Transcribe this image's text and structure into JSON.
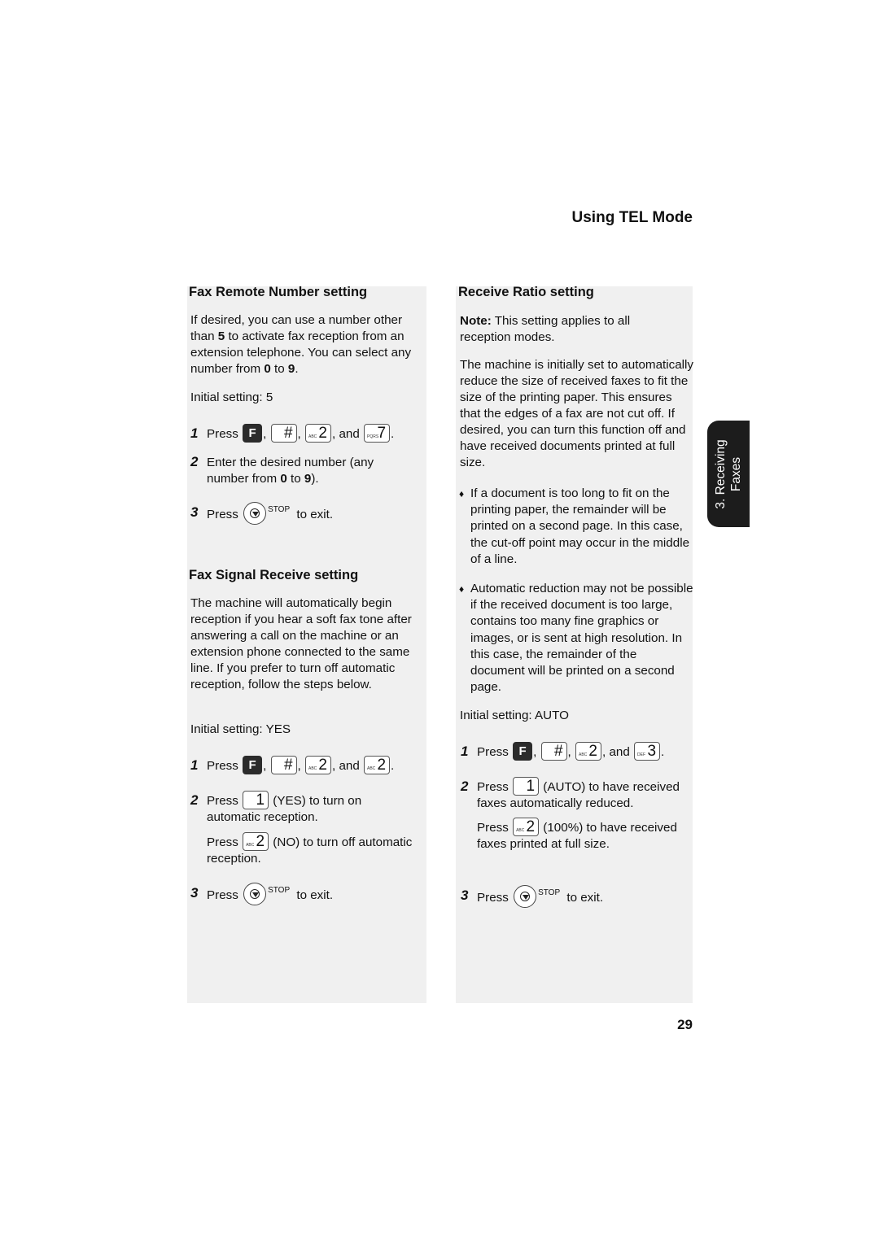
{
  "header": {
    "title": "Using TEL Mode"
  },
  "side_tab": {
    "line1": "3. Receiving",
    "line2": "Faxes"
  },
  "page_number": "29",
  "keys": {
    "f": "F",
    "hash": "#",
    "two": "2",
    "two_sub": "ABC",
    "seven": "7",
    "seven_sub": "PQRS",
    "three": "3",
    "three_sub": "DEF",
    "one": "1",
    "stop_label": "STOP"
  },
  "left": {
    "fax_remote": {
      "title": "Fax Remote Number setting",
      "intro": [
        "If desired, you can use a number other than ",
        "5",
        " to activate fax reception from an extension telephone. You can select any number from ",
        "0",
        " to ",
        "9",
        "."
      ],
      "initial": "Initial setting: 5",
      "step1": {
        "num": "1",
        "press": "Press",
        "sep1": ",",
        "sep2": ",",
        "and": ", and",
        "end": "."
      },
      "step2": {
        "num": "2",
        "text_a": "Enter the desired number (any number from ",
        "b1": "0",
        "text_b": " to ",
        "b2": "9",
        "text_c": ")."
      },
      "step3": {
        "num": "3",
        "press": "Press",
        "exit": "to exit."
      }
    },
    "fax_signal": {
      "title": "Fax Signal Receive setting",
      "intro": "The machine will automatically begin reception if you hear a soft fax tone after answering a call on the machine or an extension phone connected to the same line. If you prefer to turn off automatic reception, follow the steps below.",
      "initial": "Initial setting: YES",
      "step1": {
        "num": "1",
        "press": "Press",
        "sep1": ",",
        "sep2": ",",
        "and": ", and",
        "end": "."
      },
      "step2": {
        "num": "2",
        "press": "Press",
        "yes_text": "(YES) to turn on automatic reception.",
        "press2": "Press",
        "no_text": "(NO) to turn off automatic reception."
      },
      "step3": {
        "num": "3",
        "press": "Press",
        "exit": "to exit."
      }
    }
  },
  "right": {
    "receive_ratio": {
      "title": "Receive Ratio setting",
      "note_label": "Note:",
      "note_text": " This setting applies to all reception modes.",
      "intro": "The machine is initially set to automatically reduce the size of received faxes to fit the size of the printing paper. This ensures that the edges of a fax are not cut off. If desired, you can turn this function off and have received documents printed at full size.",
      "bullets": [
        "If a document is too long to fit on the printing paper, the remainder will be printed on a second page. In this case, the cut-off point may occur in the middle of a line.",
        "Automatic reduction may not be possible if the received document is too large, contains too many fine graphics or images, or is sent at high resolution. In this case, the remainder of the document will be printed on a second page."
      ],
      "bullet_glyph": "♦",
      "initial": "Initial setting: AUTO",
      "step1": {
        "num": "1",
        "press": "Press",
        "sep1": ",",
        "sep2": ",",
        "and": ", and",
        "end": "."
      },
      "step2": {
        "num": "2",
        "press": "Press",
        "auto_text": "(AUTO) to have received faxes automatically reduced.",
        "press2": "Press",
        "full_text": "(100%) to have received faxes printed at full size."
      },
      "step3": {
        "num": "3",
        "press": "Press",
        "exit": "to exit."
      }
    }
  }
}
